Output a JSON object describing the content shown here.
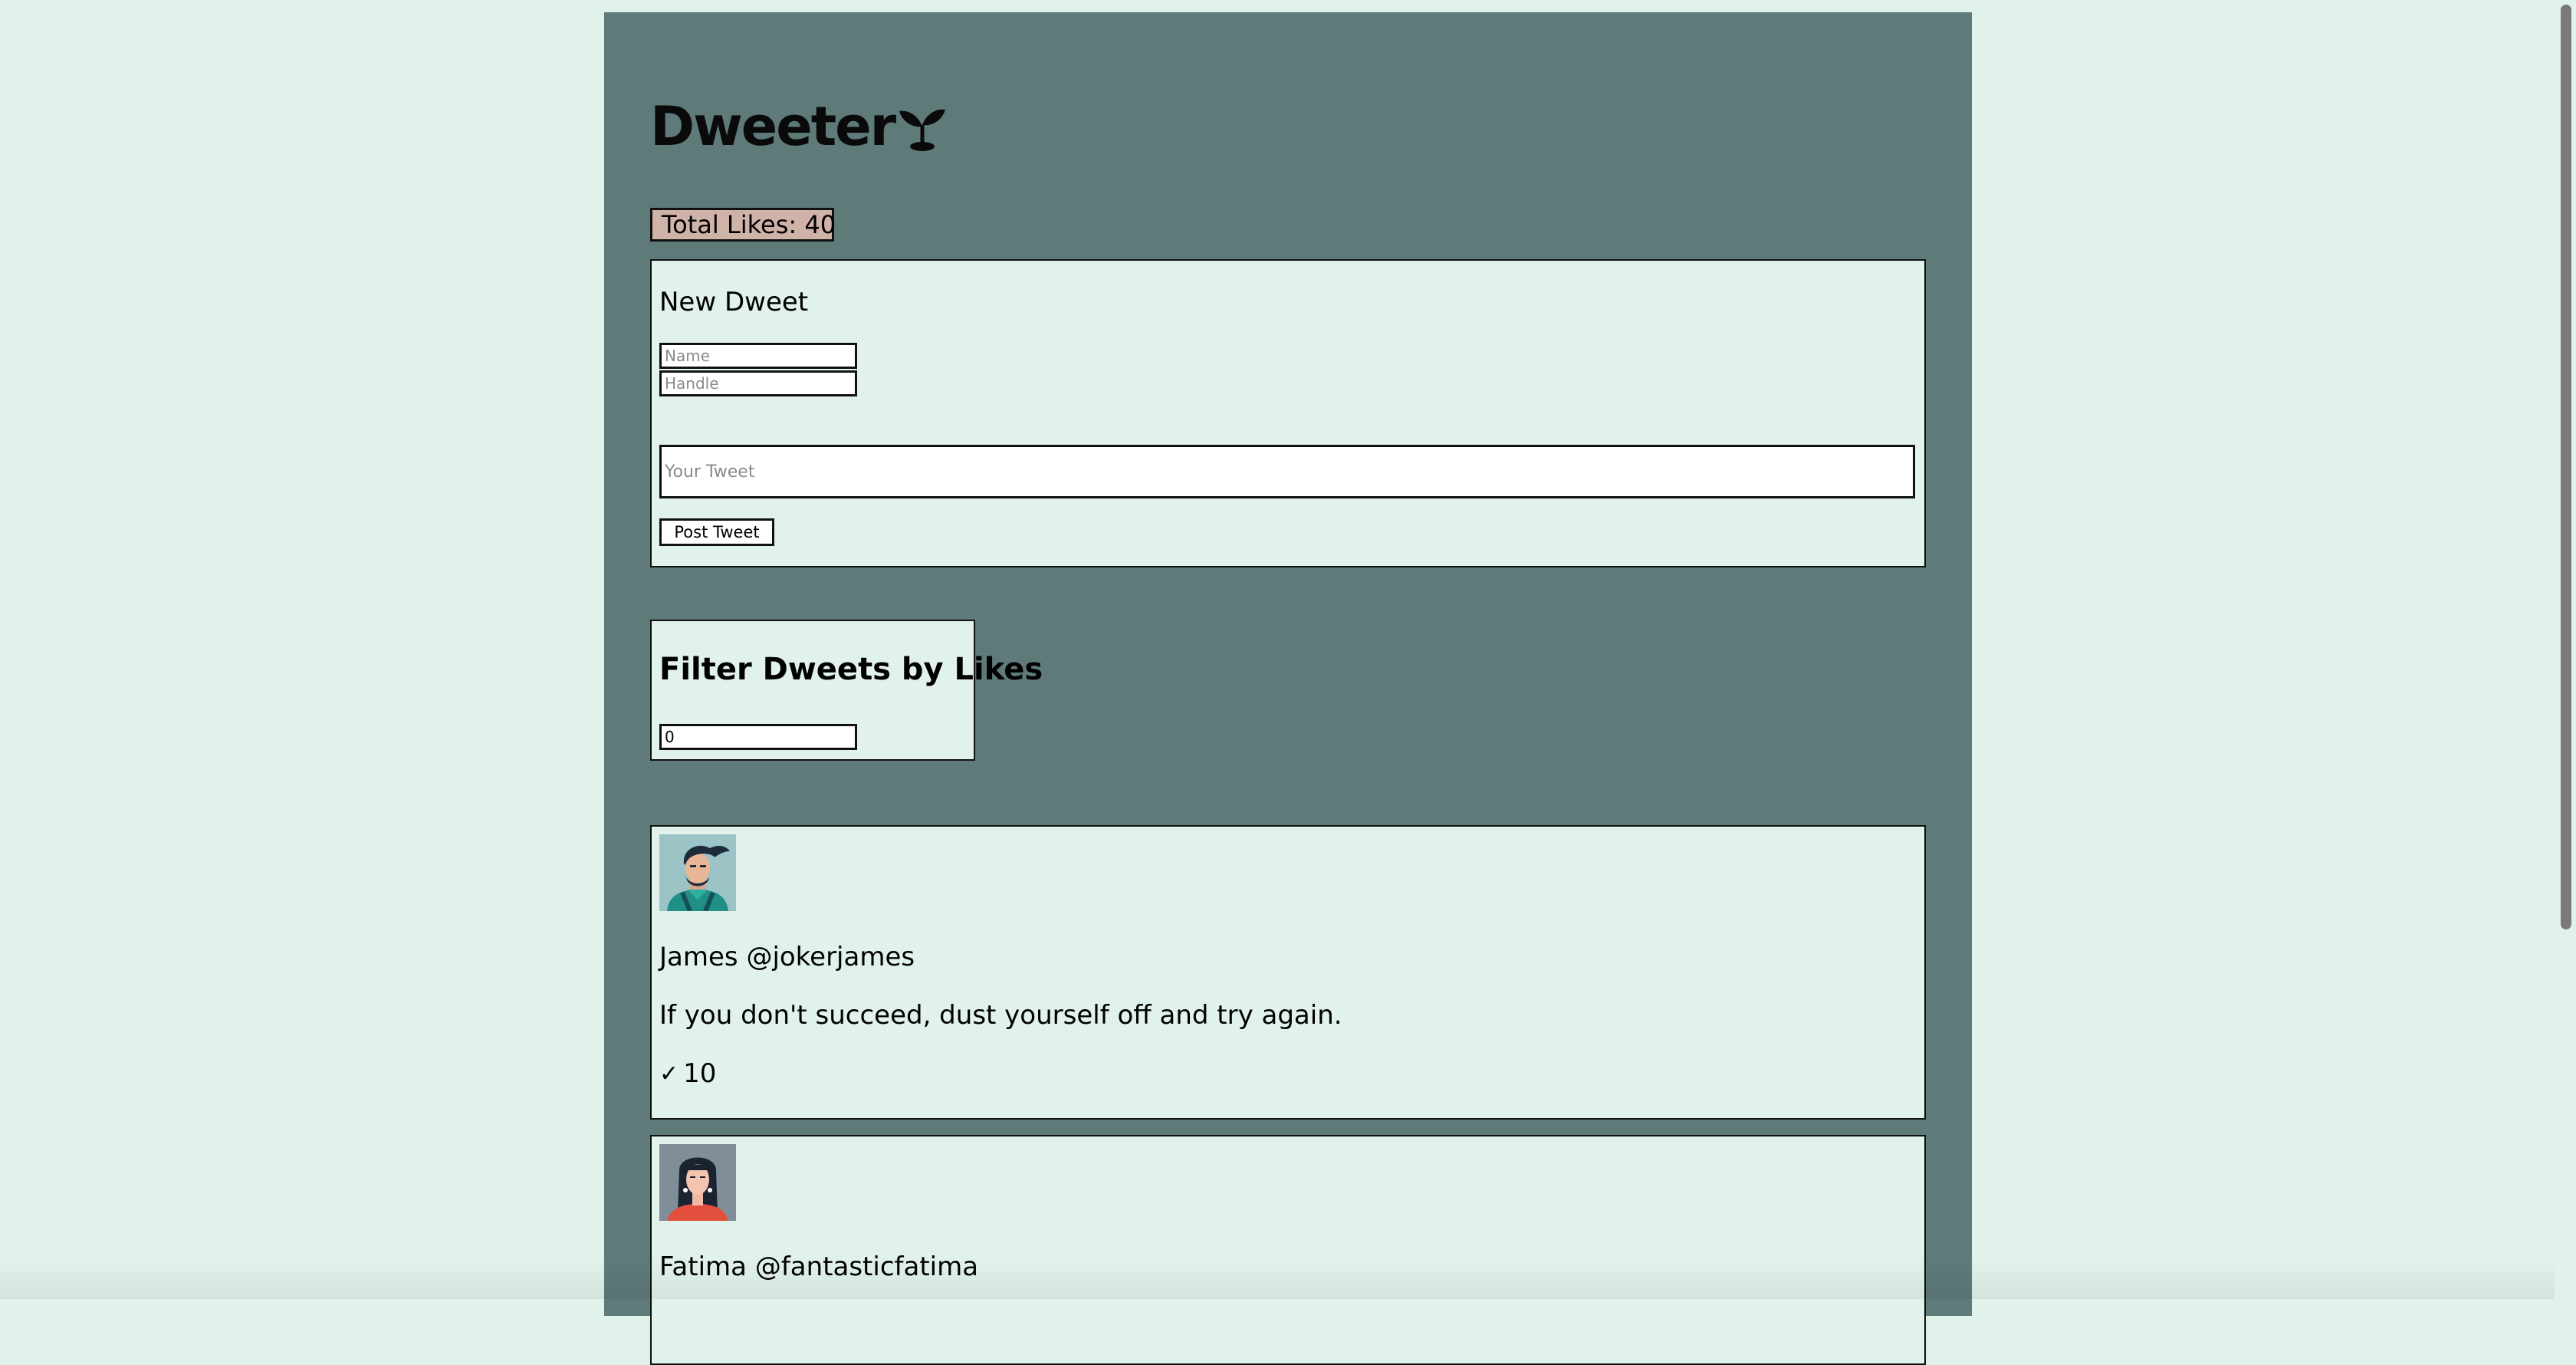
{
  "app": {
    "logo_text": "Dweeter",
    "total_likes_label": "Total Likes: 40"
  },
  "new_dweet": {
    "title": "New Dweet",
    "name_placeholder": "Name",
    "name_value": "",
    "handle_placeholder": "Handle",
    "handle_value": "",
    "tweet_placeholder": "Your Tweet",
    "tweet_value": "",
    "post_button_label": "Post Tweet"
  },
  "filter": {
    "title": "Filter Dweets by Likes",
    "min_likes_value": "0"
  },
  "dweets": [
    {
      "name": "James",
      "handle": "@jokerjames",
      "text": "If you don't succeed, dust yourself off and try again.",
      "likes": "10",
      "avatar_icon": "man-with-beard-avatar"
    },
    {
      "name": "Fatima",
      "handle": "@fantasticfatima",
      "text": "",
      "likes": "",
      "avatar_icon": "woman-with-long-hair-avatar"
    }
  ],
  "icons": {
    "logo_icon": "sprout-icon",
    "like_icon": "check-icon"
  },
  "colors": {
    "page_background": "#e1f2ea",
    "app_background": "#5e7b79",
    "likes_badge": "#d0b3a8"
  }
}
